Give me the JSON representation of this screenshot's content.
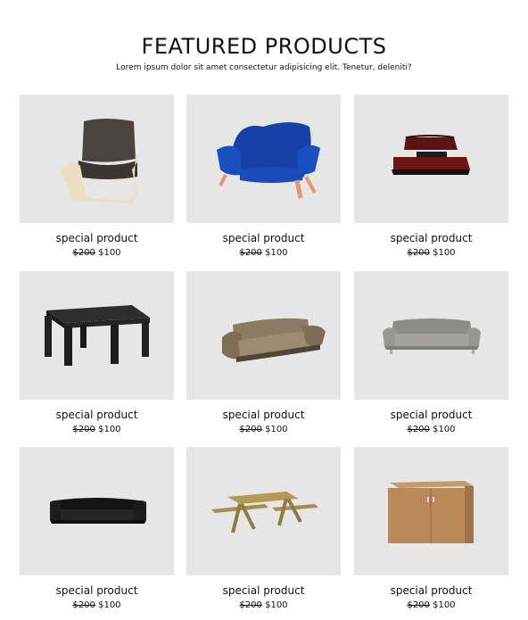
{
  "header": {
    "title": "FEATURED PRODUCTS",
    "subtitle": "Lorem ipsum dolor sit amet consectetur adipisicing elit. Tenetur, deleniti?"
  },
  "products": [
    {
      "name": "special product",
      "old_price": "$200",
      "price": "$100",
      "image": "armchair-icon"
    },
    {
      "name": "special product",
      "old_price": "$200",
      "price": "$100",
      "image": "blue-armchair-icon"
    },
    {
      "name": "special product",
      "old_price": "$200",
      "price": "$100",
      "image": "bed-icon"
    },
    {
      "name": "special product",
      "old_price": "$200",
      "price": "$100",
      "image": "table-icon"
    },
    {
      "name": "special product",
      "old_price": "$200",
      "price": "$100",
      "image": "sofa-icon"
    },
    {
      "name": "special product",
      "old_price": "$200",
      "price": "$100",
      "image": "grey-sofa-icon"
    },
    {
      "name": "special product",
      "old_price": "$200",
      "price": "$100",
      "image": "leather-sofa-icon"
    },
    {
      "name": "special product",
      "old_price": "$200",
      "price": "$100",
      "image": "picnic-table-icon"
    },
    {
      "name": "special product",
      "old_price": "$200",
      "price": "$100",
      "image": "cabinet-icon"
    }
  ]
}
